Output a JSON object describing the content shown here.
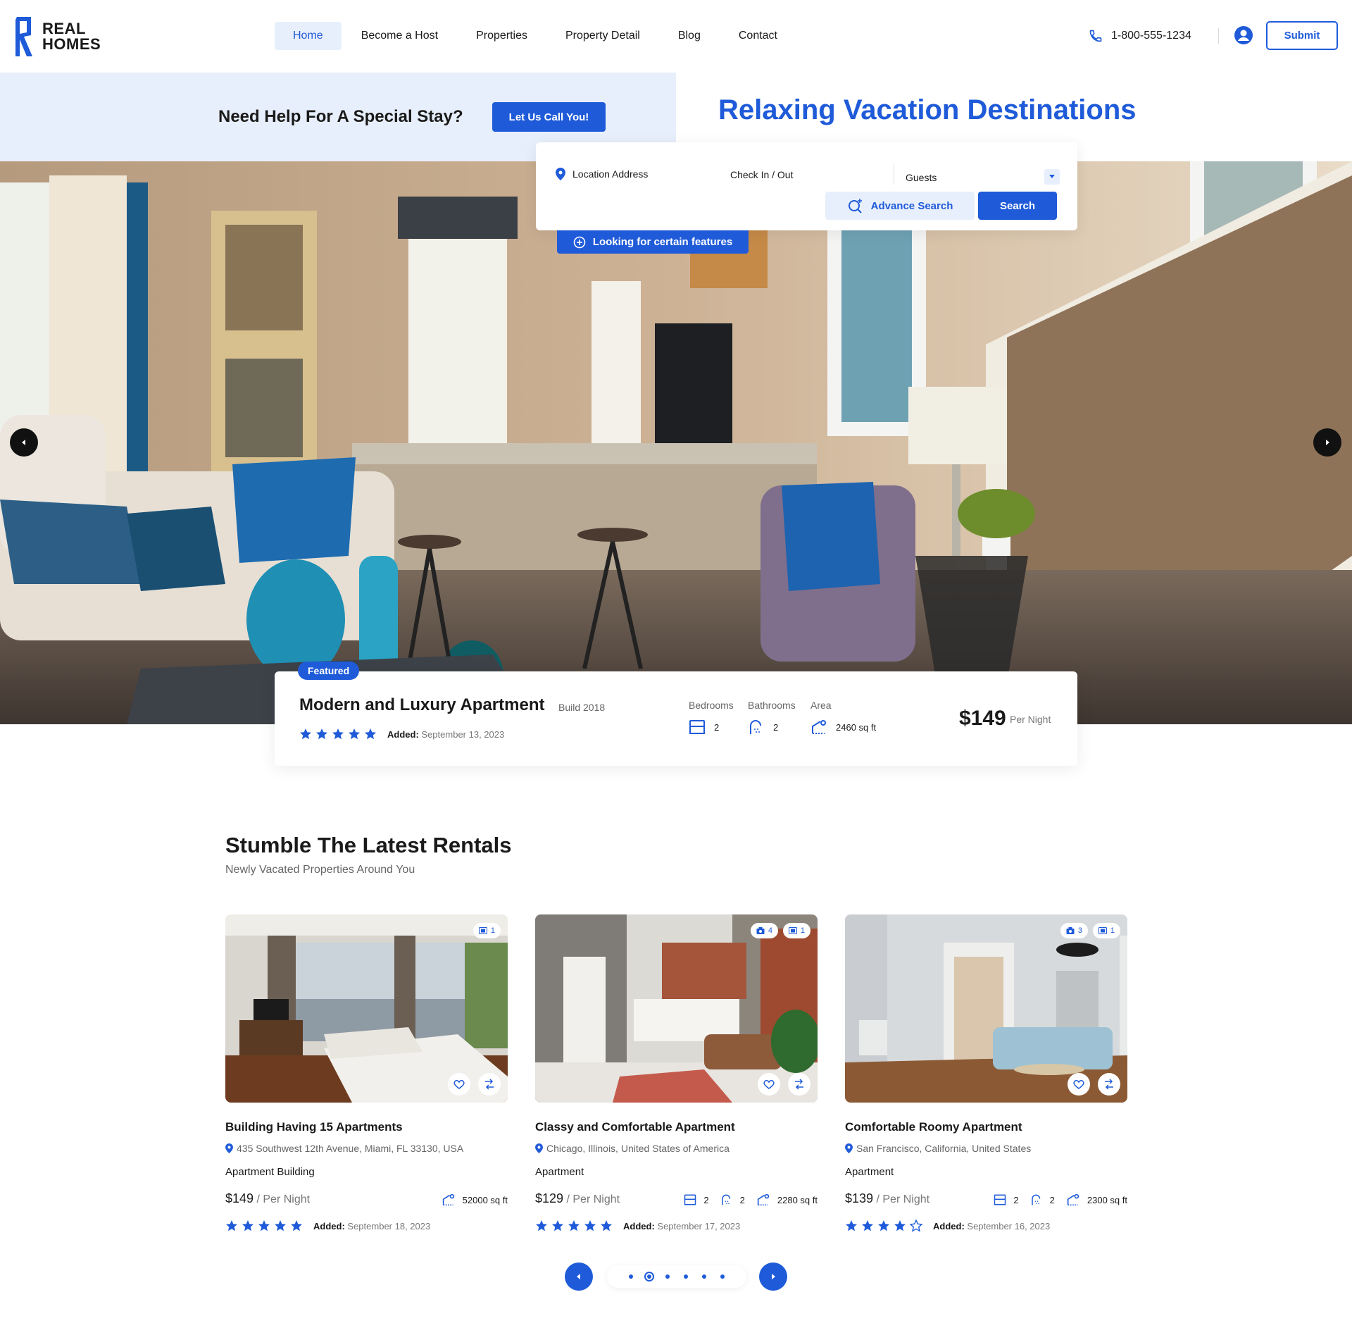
{
  "brand": {
    "line1": "REAL",
    "line2": "HOMES"
  },
  "nav": {
    "items": [
      "Home",
      "Become a Host",
      "Properties",
      "Property Detail",
      "Blog",
      "Contact"
    ],
    "active_index": 0
  },
  "header": {
    "phone": "1-800-555-1234",
    "submit_label": "Submit"
  },
  "help": {
    "text": "Need Help For A Special Stay?",
    "button": "Let Us Call You!"
  },
  "hero": {
    "title": "Relaxing Vacation Destinations"
  },
  "search": {
    "location_label": "Location Address",
    "checkin_label": "Check In / Out",
    "guests_label": "Guests",
    "advance_label": "Advance Search",
    "search_label": "Search",
    "features_label": "Looking for certain features"
  },
  "featured": {
    "badge": "Featured",
    "title": "Modern and Luxury Apartment",
    "build": "Build 2018",
    "rating": 5,
    "added_label": "Added:",
    "added_date": "September 13, 2023",
    "bedrooms_label": "Bedrooms",
    "bedrooms": "2",
    "bathrooms_label": "Bathrooms",
    "bathrooms": "2",
    "area_label": "Area",
    "area": "2460 sq ft",
    "price": "$149",
    "price_unit": "Per Night"
  },
  "section": {
    "title": "Stumble The Latest Rentals",
    "subtitle": "Newly Vacated Properties Around You"
  },
  "cards": [
    {
      "title": "Building Having 15 Apartments",
      "address": "435 Southwest 12th Avenue, Miami, FL 33130, USA",
      "type": "Apartment Building",
      "price": "$149",
      "price_unit": " / Per Night",
      "area": "52000 sq ft",
      "beds": "",
      "baths": "",
      "photos": "",
      "videos": "1",
      "rating": 5,
      "added_label": "Added:",
      "added_date": "September 18, 2023"
    },
    {
      "title": "Classy and Comfortable Apartment",
      "address": "Chicago, Illinois, United States of America",
      "type": "Apartment",
      "price": "$129",
      "price_unit": " / Per Night",
      "area": "2280 sq ft",
      "beds": "2",
      "baths": "2",
      "photos": "4",
      "videos": "1",
      "rating": 5,
      "added_label": "Added:",
      "added_date": "September 17, 2023"
    },
    {
      "title": "Comfortable Roomy Apartment",
      "address": "San Francisco, California, United States",
      "type": "Apartment",
      "price": "$139",
      "price_unit": " / Per Night",
      "area": "2300 sq ft",
      "beds": "2",
      "baths": "2",
      "photos": "3",
      "videos": "1",
      "rating": 4,
      "added_label": "Added:",
      "added_date": "September 16, 2023"
    }
  ],
  "carousel": {
    "dot_count": 6,
    "active_dot": 1
  },
  "colors": {
    "accent": "#1f5bd9",
    "accent_light": "#e8effc",
    "text": "#1a1a1a"
  }
}
